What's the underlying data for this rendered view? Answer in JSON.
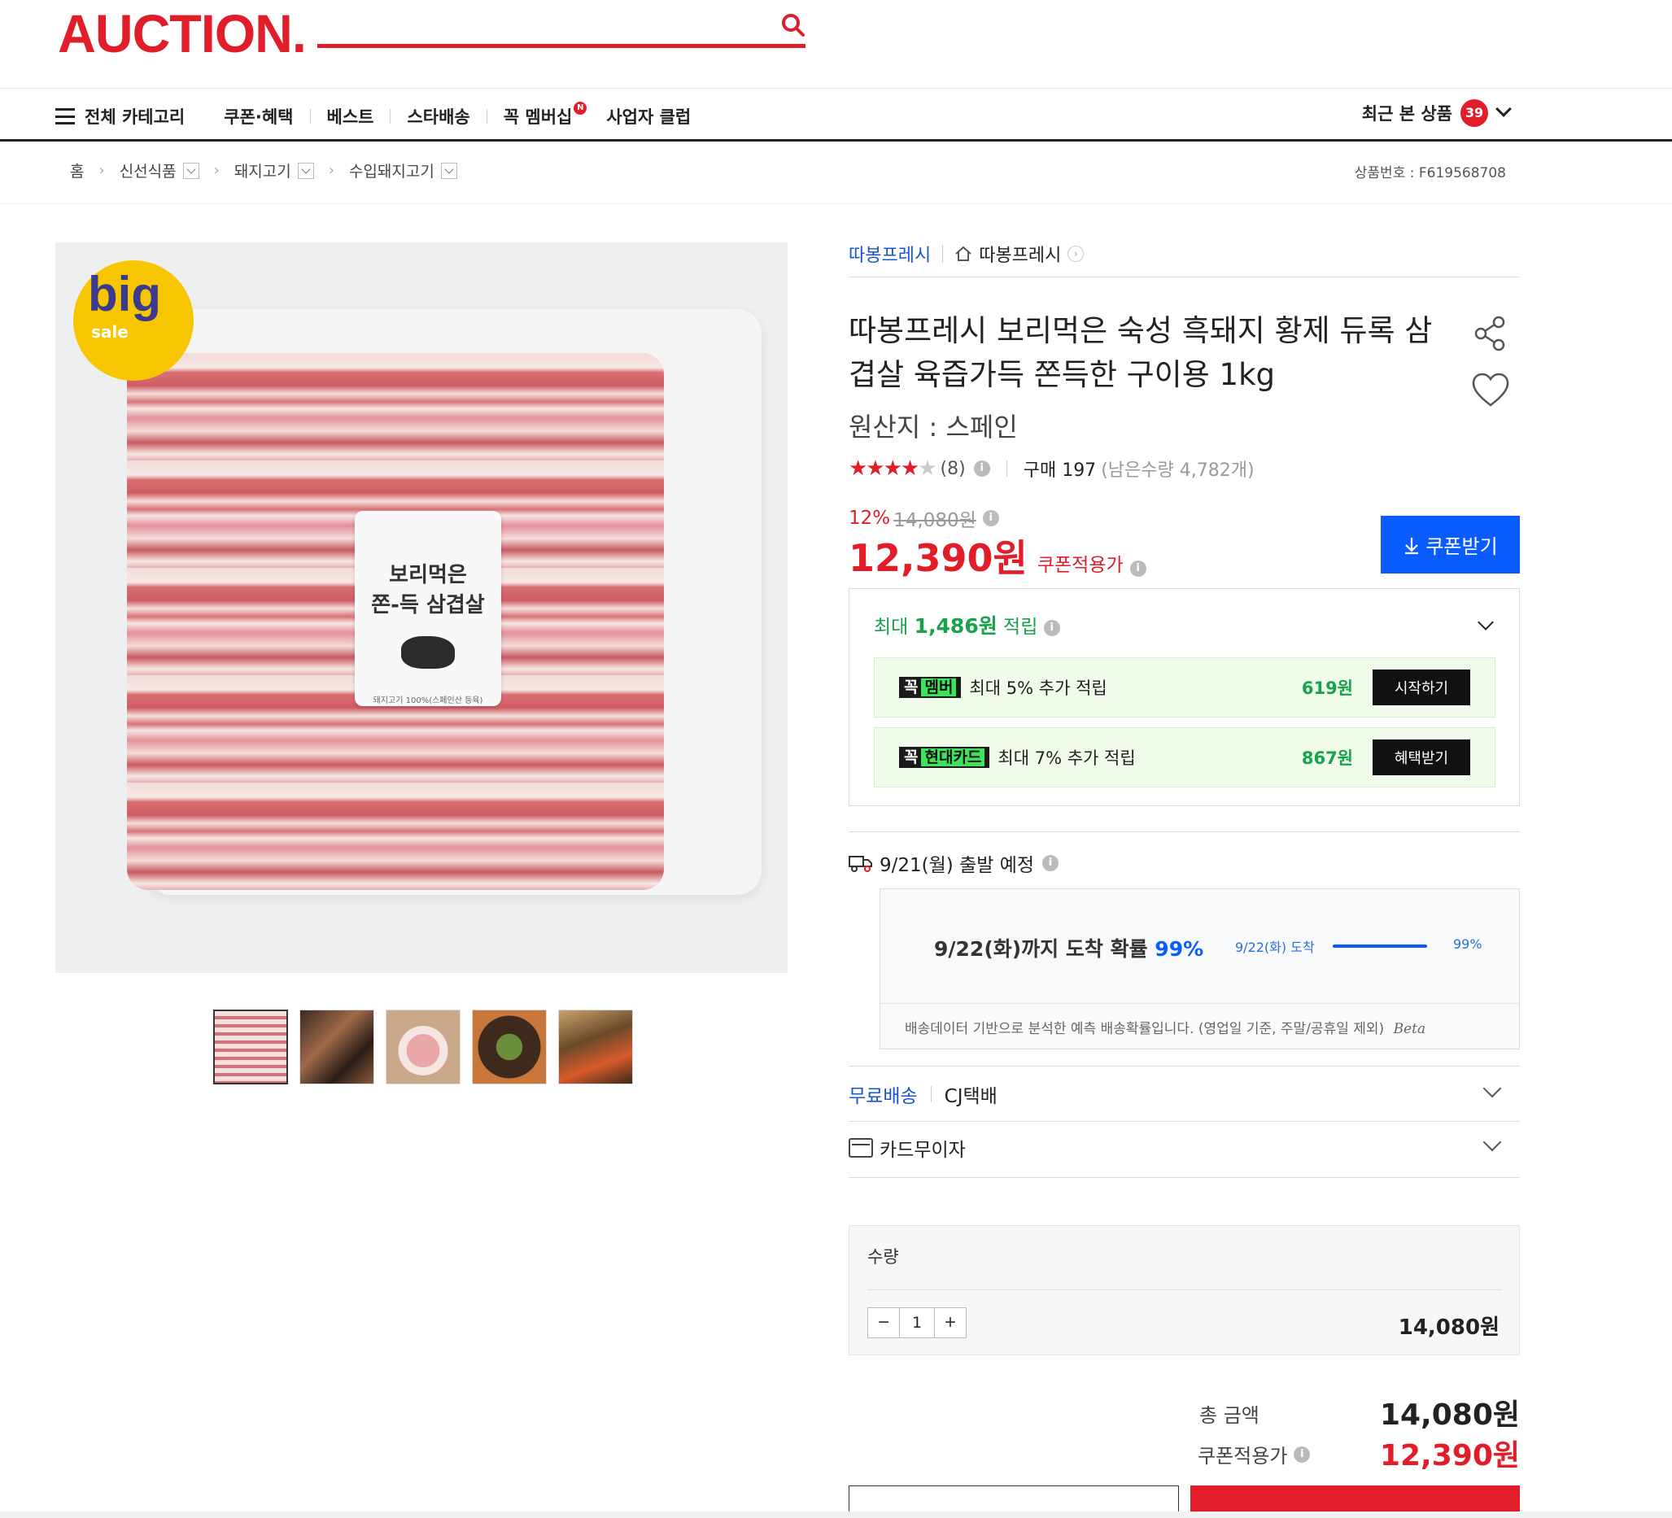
{
  "header": {
    "logo": "AUCTION.",
    "nav": {
      "all_categories": "전체 카테고리",
      "items": [
        "쿠폰·혜택",
        "베스트",
        "스타배송",
        "꼭 멤버십",
        "사업자 클럽"
      ],
      "membership_badge": "N"
    },
    "recent": {
      "label": "최근 본 상품",
      "count": "39"
    }
  },
  "breadcrumb": {
    "home": "홈",
    "levels": [
      "신선식품",
      "돼지고기",
      "수입돼지고기"
    ],
    "product_no": "상품번호 : F619568708"
  },
  "gallery": {
    "badge_big": "big",
    "badge_sale": "sale",
    "label_line1": "보리먹은",
    "label_line2": "쫀-득 삼겹살",
    "label_small": "돼지고기 100%(스페인산 등육)"
  },
  "product": {
    "seller": "따봉프레시",
    "store": "따봉프레시",
    "title": "따봉프레시 보리먹은 숙성 흑돼지 황제 듀록 삼겹살 육즙가득 쫀득한 구이용 1kg",
    "origin": "원산지 : 스페인",
    "rating": {
      "stars_filled": "★★★★",
      "stars_empty": "★",
      "reviews": "(8)",
      "info": "i"
    },
    "purchases": "구매 197",
    "stock": "(남은수량 4,782개)",
    "discount_pct": "12%",
    "original_price": "14,080원",
    "price": "12,390원",
    "price_label": "쿠폰적용가",
    "coupon_button": "쿠폰받기"
  },
  "rewards": {
    "head_prefix": "최대",
    "head_amount": "1,486원",
    "head_suffix": "적립",
    "perks": [
      {
        "tag": "꼭",
        "tag_name": "멤버",
        "text": "최대 5% 추가 적립",
        "amount": "619원",
        "action": "시작하기"
      },
      {
        "tag": "꼭",
        "tag_name": "현대카드",
        "text": "최대 7% 추가 적립",
        "amount": "867원",
        "action": "혜택받기"
      }
    ]
  },
  "shipping": {
    "depart": "9/21(월) 출발 예정",
    "eta_text": "9/22(화)까지 도착 확률",
    "eta_pct": "99%",
    "bar_label": "9/22(화) 도착",
    "bar_pct": "99%",
    "bar_value": 0.99,
    "note": "배송데이터 기반으로 분석한 예측 배송확률입니다. (영업일 기준, 주말/공휴일 제외)",
    "beta": "Beta",
    "free_label": "무료배송",
    "carrier": "CJ택배",
    "installment": "카드무이자"
  },
  "order": {
    "qty_label": "수량",
    "minus": "−",
    "qty": "1",
    "plus": "+",
    "qty_price": "14,080원",
    "total_label": "총 금액",
    "total": "14,080원",
    "coupon_label": "쿠폰적용가",
    "coupon_total": "12,390원"
  },
  "colors": {
    "brand_red": "#e11d2a",
    "blue": "#0b5cff",
    "green": "#16a34a"
  }
}
